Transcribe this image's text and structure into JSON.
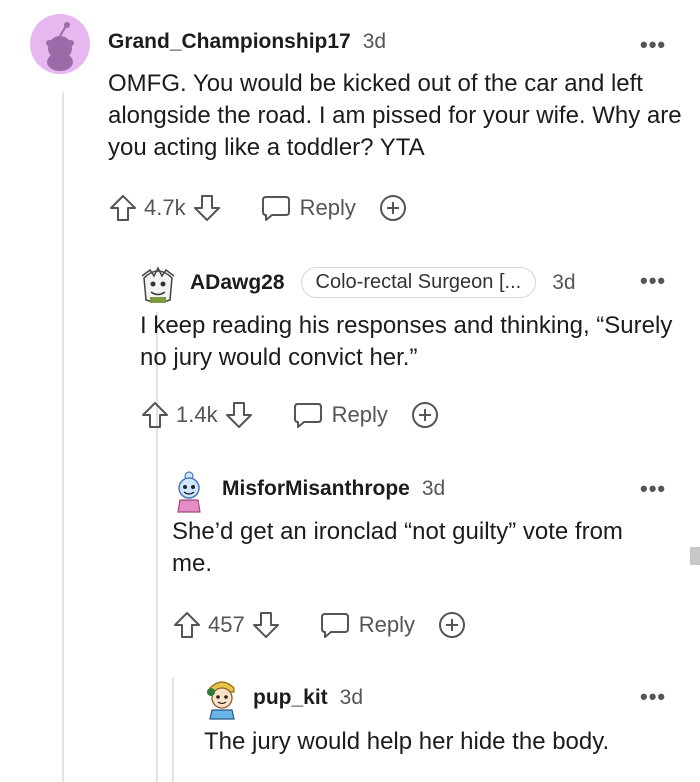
{
  "comments": [
    {
      "username": "Grand_Championship17",
      "time": "3d",
      "text": "OMFG. You would be kicked out of the car and left alongside the road. I am pissed for your wife. Why are you acting like a toddler? YTA",
      "votes": "4.7k",
      "reply_label": "Reply"
    },
    {
      "username": "ADawg28",
      "flair": "Colo-rectal Surgeon [...",
      "time": "3d",
      "text": "I keep reading his responses and thinking, “Surely no jury would convict her.”",
      "votes": "1.4k",
      "reply_label": "Reply"
    },
    {
      "username": "MisforMisanthrope",
      "time": "3d",
      "text": "She’d get an ironclad “not guilty” vote from me.",
      "votes": "457",
      "reply_label": "Reply"
    },
    {
      "username": "pup_kit",
      "time": "3d",
      "text": "The jury would help her hide the body."
    }
  ],
  "more_label": "•••",
  "icons": {
    "upvote": "arrow-up-icon",
    "downvote": "arrow-down-icon",
    "reply": "speech-bubble-icon",
    "award": "plus-circle-icon",
    "more": "more-dots-icon"
  },
  "colors": {
    "default_avatar_bg": "#e7b8f0",
    "default_avatar_fg": "#9b6aa8",
    "text": "#1c1c1c",
    "meta": "#555555",
    "thread_line": "#e3e3e3"
  }
}
